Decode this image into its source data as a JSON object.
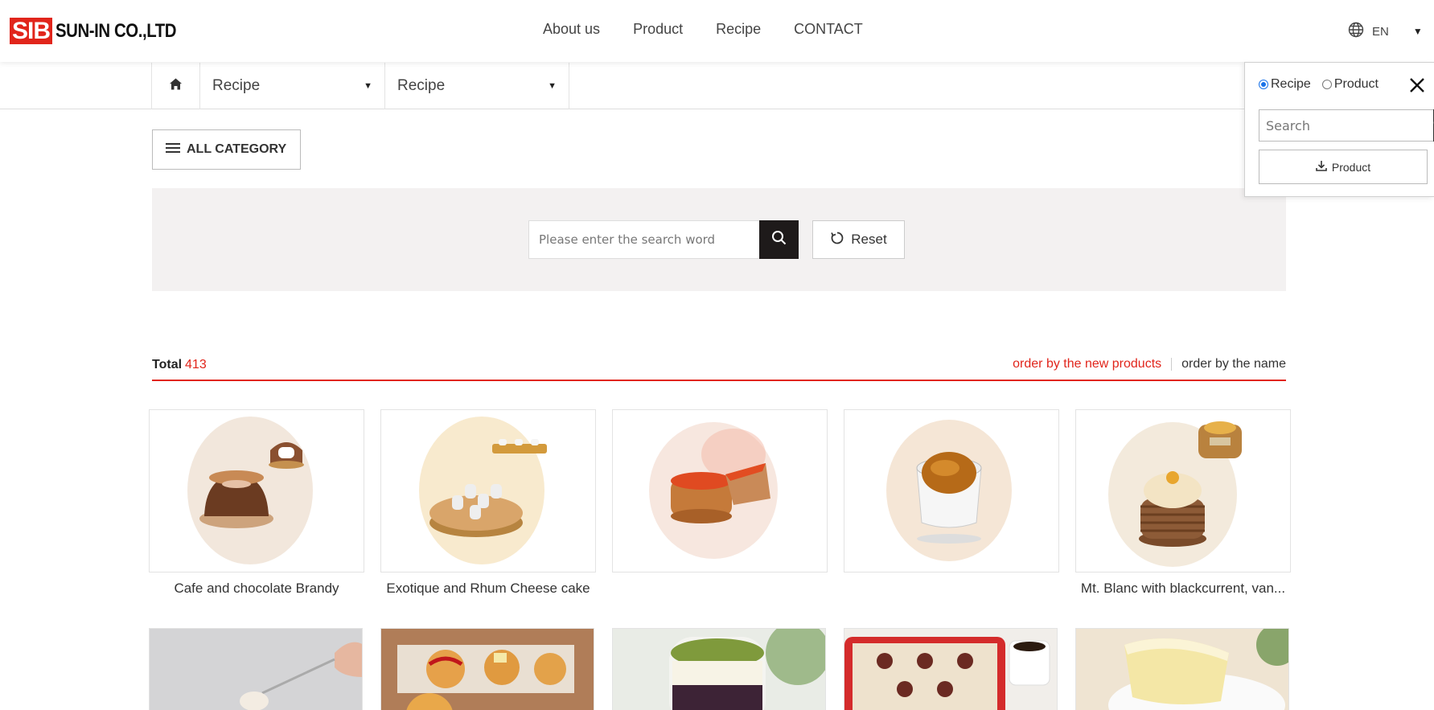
{
  "header": {
    "logo_mark": "SIB",
    "logo_text": "SUN-IN CO.,LTD",
    "nav": [
      "About us",
      "Product",
      "Recipe",
      "CONTACT"
    ],
    "lang": "EN"
  },
  "subnav": {
    "dropdown1": "Recipe",
    "dropdown2": "Recipe"
  },
  "all_category_label": "ALL CATEGORY",
  "search": {
    "placeholder": "Please enter the search word",
    "reset_label": "Reset"
  },
  "listing": {
    "total_label": "Total",
    "total_count": "413",
    "sort_new": "order by the new products",
    "sort_name": "order by the name"
  },
  "cards": [
    {
      "title": "Cafe and chocolate Brandy",
      "icon": "chocolate-dome-cake"
    },
    {
      "title": "Exotique and Rhum Cheese cake",
      "icon": "cheese-cake"
    },
    {
      "title": "",
      "icon": "charlotte-cake"
    },
    {
      "title": "",
      "icon": "creme-brulee"
    },
    {
      "title": "Mt. Blanc with blackcurrent, van...",
      "icon": "mont-blanc"
    }
  ],
  "popup": {
    "radio_recipe": "Recipe",
    "radio_product": "Product",
    "selected": "Recipe",
    "search_placeholder": "Search",
    "product_button": "Product"
  },
  "colors": {
    "brand_red": "#e1251b",
    "dark_button": "#1e1a1a",
    "band_bg": "#f3f1f1",
    "radio_blue": "#1a73e8"
  }
}
